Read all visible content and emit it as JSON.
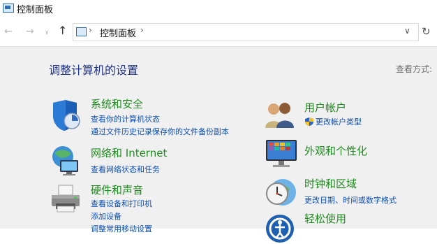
{
  "window": {
    "title": "控制面板"
  },
  "nav": {
    "back_glyph": "←",
    "forward_glyph": "→",
    "recent_glyph": "∨",
    "up_glyph": "↑",
    "refresh_glyph": "↻"
  },
  "address": {
    "separator": "›",
    "crumb": "控制面板",
    "dropdown_glyph": "∨"
  },
  "page": {
    "title": "调整计算机的设置",
    "view_label": "查看方式:"
  },
  "left_categories": [
    {
      "title": "系统和安全",
      "icon": "shield-icon",
      "links": [
        "查看你的计算机状态",
        "通过文件历史记录保存你的文件备份副本"
      ]
    },
    {
      "title": "网络和 Internet",
      "icon": "network-icon",
      "links": [
        "查看网络状态和任务"
      ]
    },
    {
      "title": "硬件和声音",
      "icon": "printer-icon",
      "links": [
        "查看设备和打印机",
        "添加设备",
        "调整常用移动设置"
      ]
    }
  ],
  "right_categories": [
    {
      "title": "用户帐户",
      "icon": "users-icon",
      "links": [
        "更改帐户类型"
      ]
    },
    {
      "title": "外观和个性化",
      "icon": "monitor-icon",
      "links": []
    },
    {
      "title": "时钟和区域",
      "icon": "clock-globe-icon",
      "links": [
        "更改日期、时间或数字格式"
      ]
    },
    {
      "title": "轻松使用",
      "icon": "accessibility-icon",
      "links": []
    }
  ],
  "colors": {
    "category_title": "#1f8a1f",
    "link": "#0b4fb6",
    "page_title": "#1e3287",
    "content_bg": "#f0f0f0"
  }
}
